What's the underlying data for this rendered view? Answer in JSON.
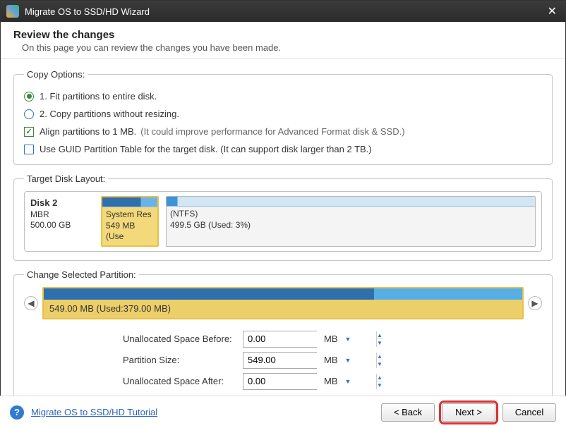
{
  "window": {
    "title": "Migrate OS to SSD/HD Wizard"
  },
  "header": {
    "title": "Review the changes",
    "subtitle": "On this page you can review the changes you have been made."
  },
  "copy_options": {
    "legend": "Copy Options:",
    "radio1": "1. Fit partitions to entire disk.",
    "radio1_checked": true,
    "radio2": "2. Copy partitions without resizing.",
    "radio2_checked": false,
    "align_label": "Align partitions to 1 MB.",
    "align_hint": "(It could improve performance for Advanced Format disk & SSD.)",
    "align_checked": true,
    "gpt_label": "Use GUID Partition Table for the target disk. (It can support disk larger than 2 TB.)",
    "gpt_checked": false
  },
  "target_layout": {
    "legend": "Target Disk Layout:",
    "disk_name": "Disk 2",
    "disk_scheme": "MBR",
    "disk_size": "500.00 GB",
    "part1_name": "System Res",
    "part1_sub": "549 MB (Use",
    "part2_name": "(NTFS)",
    "part2_sub": "499.5 GB (Used: 3%)"
  },
  "change_partition": {
    "legend": "Change Selected Partition:",
    "selected_label": "549.00 MB (Used:379.00 MB)",
    "fields": {
      "before_label": "Unallocated Space Before:",
      "before_value": "0.00",
      "size_label": "Partition Size:",
      "size_value": "549.00",
      "after_label": "Unallocated Space After:",
      "after_value": "0.00",
      "unit": "MB"
    }
  },
  "footer": {
    "help_text": "Migrate OS to SSD/HD Tutorial",
    "back": "< Back",
    "next": "Next >",
    "cancel": "Cancel"
  }
}
